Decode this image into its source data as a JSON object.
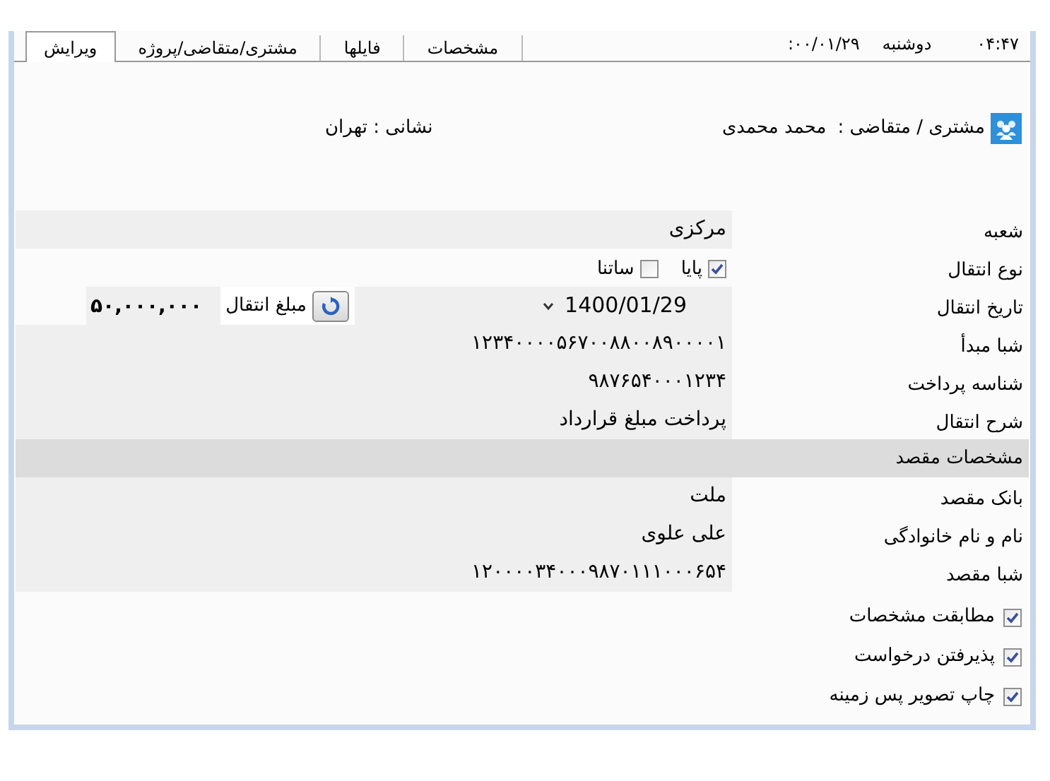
{
  "clock": {
    "time": "۰۴:۴۷",
    "day": "دوشنبه",
    "date": "۰۰/۰۱/۲۹:"
  },
  "tabs": [
    {
      "label": "مشخصات",
      "selected": false
    },
    {
      "label": "فایلها",
      "selected": false
    },
    {
      "label": "مشتری/متقاضی/پروژه",
      "selected": false
    },
    {
      "label": "ویرایش",
      "selected": true
    }
  ],
  "header": {
    "customer_label": "مشتری / متقاضی :",
    "customer_name": "محمد محمدی",
    "address": "نشانی : تهران"
  },
  "fields": [
    {
      "kind": "text",
      "label": "شعبه",
      "value": "مرکزی"
    },
    {
      "kind": "checks",
      "label": "نوع انتقال",
      "options": [
        {
          "label": "پایا",
          "checked": true
        },
        {
          "label": "ساتنا",
          "checked": false
        }
      ]
    },
    {
      "kind": "date_amount",
      "label": "تاریخ انتقال",
      "date": "1400/01/29",
      "amount_label": "مبلغ انتقال",
      "amount": "۵۰,۰۰۰,۰۰۰"
    },
    {
      "kind": "text",
      "label": "شبا مبدأ",
      "value": "۱۲۳۴۰۰۰۰۵۶۷۰۰۸۸۰۰۸۹۰۰۰۰۱"
    },
    {
      "kind": "text",
      "label": "شناسه پرداخت",
      "value": "۹۸۷۶۵۴۰۰۰۱۲۳۴"
    },
    {
      "kind": "text",
      "label": "شرح انتقال",
      "value": "پرداخت مبلغ قرارداد"
    },
    {
      "kind": "section",
      "label": "مشخصات مقصد"
    },
    {
      "kind": "text",
      "label": "بانک مقصد",
      "value": "ملت"
    },
    {
      "kind": "text",
      "label": "نام و نام خانوادگی",
      "value": "علی علوی"
    },
    {
      "kind": "text",
      "label": "شبا مقصد",
      "value": "۱۲۰۰۰۰۳۴۰۰۰۹۸۷۰۱۱۱۰۰۰۶۵۴"
    }
  ],
  "options": [
    {
      "label": "مطابقت مشخصات",
      "checked": true
    },
    {
      "label": "پذیرفتن درخواست",
      "checked": true
    },
    {
      "label": "چاپ تصویر پس زمینه",
      "checked": true
    }
  ]
}
